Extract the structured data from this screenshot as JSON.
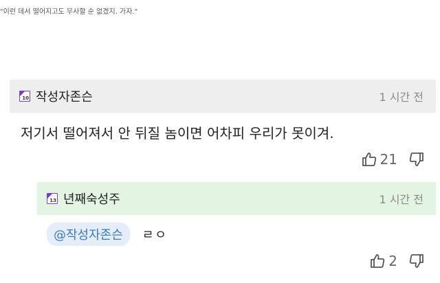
{
  "quote_line": "\"이런 데서 떨어지고도 무사할 순 없겠지. 가자.\"",
  "comments": {
    "main": {
      "author": "작성자존슨",
      "level": "10",
      "timestamp": "1 시간 전",
      "text": "저기서 떨어져서 안 뒤질 놈이면 어차피 우리가 못이겨.",
      "likes": "21"
    },
    "reply": {
      "author": "년째숙성주",
      "level": "13",
      "timestamp": "1 시간 전",
      "mention": "@작성자존슨",
      "text": "ㄹㅇ",
      "likes": "2"
    }
  },
  "colors": {
    "main_header_bg": "#eeeeee",
    "reply_header_bg": "#e3f4e3",
    "mention_bg": "#e5eef8",
    "mention_text": "#3b7bbf",
    "badge_accent": "#7b3fbf"
  },
  "icons": {
    "like": "thumbs-up-icon",
    "dislike": "thumbs-down-icon",
    "level": "level-badge-icon"
  }
}
